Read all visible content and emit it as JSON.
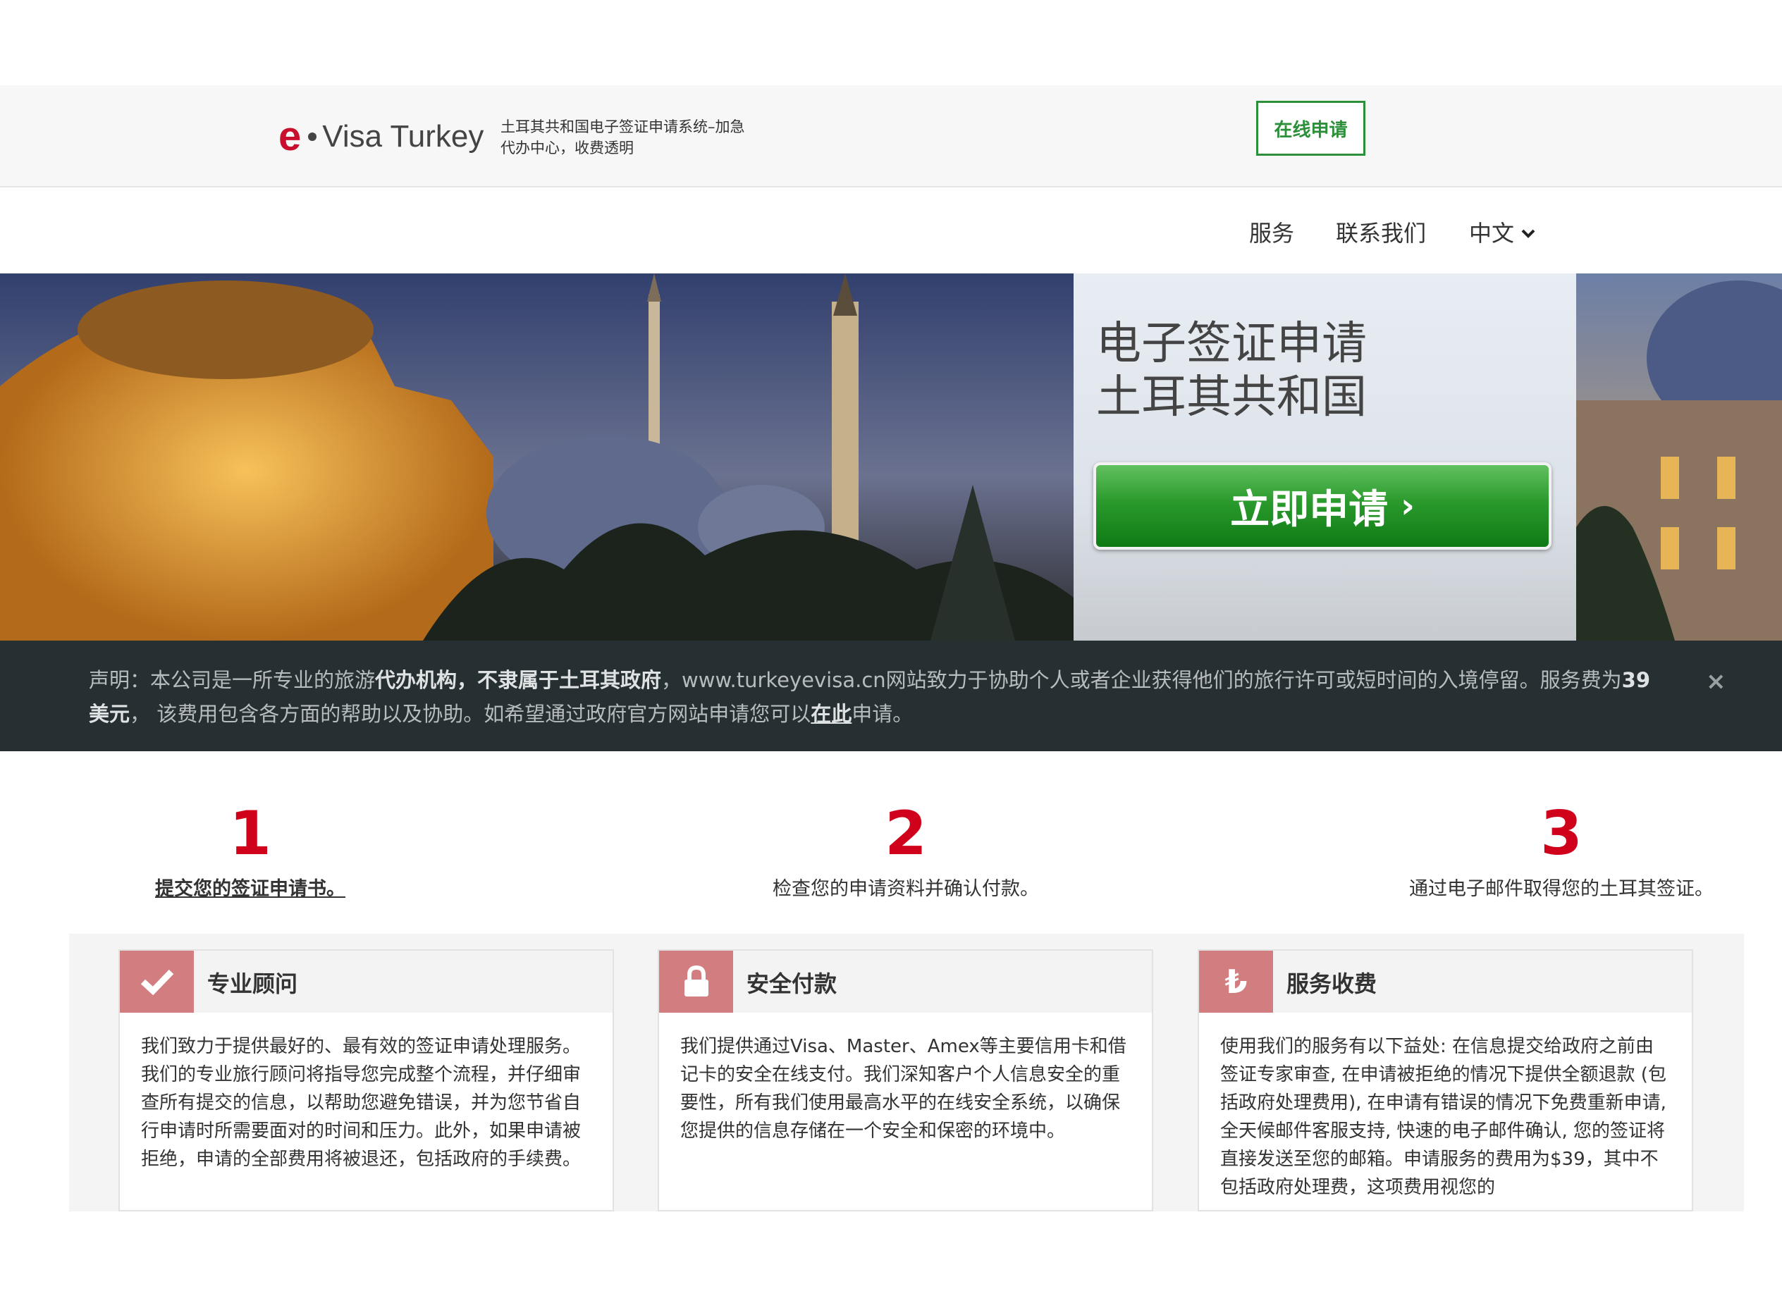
{
  "header": {
    "logo_e": "e",
    "logo_text": "Visa Turkey",
    "tagline": "土耳其共和国电子签证申请系统–加急代办中心，收费透明",
    "online_apply": "在线申请"
  },
  "nav": {
    "services": "服务",
    "contact": "联系我们",
    "language": "中文"
  },
  "hero": {
    "title_line1": "电子签证申请",
    "title_line2": "土耳其共和国",
    "apply_now": "立即申请",
    "apply_arrow": "›"
  },
  "disclaimer": {
    "prefix": "声明：本公司是一所专业的旅游",
    "bold1": "代办机构，不隶属于土耳其政府",
    "middle": "，www.turkeyevisa.cn网站致力于协助个人或者企业获得他们的旅行许可或短时间的入境停留。服务费为",
    "bold2": "39美元",
    "after_fee": "， 该费用包含各方面的帮助以及协助。如希望通过政府官方网站申请您可以",
    "link": "在此",
    "suffix": "申请。",
    "close": "×"
  },
  "steps": [
    {
      "num": "1",
      "text": "提交您的签证申请书。"
    },
    {
      "num": "2",
      "text": "检查您的申请资料并确认付款。"
    },
    {
      "num": "3",
      "text": "通过电子邮件取得您的土耳其签证。"
    }
  ],
  "features": [
    {
      "icon": "check-icon",
      "title": "专业顾问",
      "body": "我们致力于提供最好的、最有效的签证申请处理服务。我们的专业旅行顾问将指导您完成整个流程，并仔细审查所有提交的信息，以帮助您避免错误，并为您节省自行申请时所需要面对的时间和压力。此外，如果申请被拒绝，申请的全部费用将被退还，包括政府的手续费。"
    },
    {
      "icon": "lock-icon",
      "title": "安全付款",
      "body": "我们提供通过Visa、Master、Amex等主要信用卡和借记卡的安全在线支付。我们深知客户个人信息安全的重要性，所有我们使用最高水平的在线安全系统，以确保您提供的信息存储在一个安全和保密的环境中。"
    },
    {
      "icon": "lira-icon",
      "icon_glyph": "₺",
      "title": "服务收费",
      "body": "使用我们的服务有以下益处: 在信息提交给政府之前由签证专家审查, 在申请被拒绝的情况下提供全额退款 (包括政府处理费用), 在申请有错误的情况下免费重新申请, 全天候邮件客服支持, 快速的电子邮件确认, 您的签证将直接发送至您的邮箱。申请服务的费用为$39，其中不包括政府处理费，这项费用视您的"
    }
  ]
}
